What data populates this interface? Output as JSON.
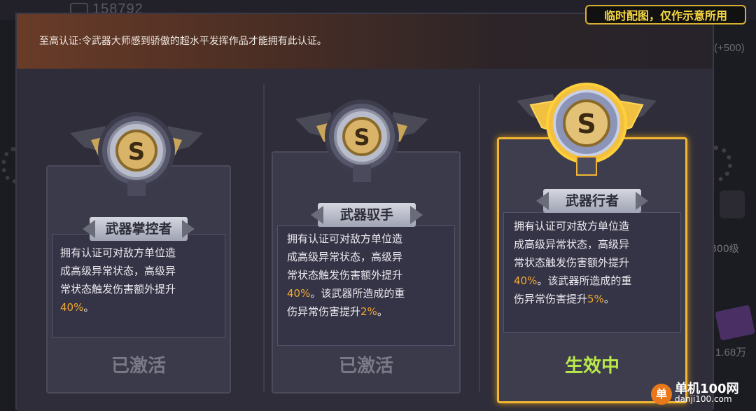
{
  "background": {
    "top_number": "158792",
    "right_bonus": "(+500)",
    "right_level": "300级",
    "right_price": "1.68万"
  },
  "notice": "临时配图，仅作示意所用",
  "header": {
    "text": "至高认证:令武器大师感到骄傲的超水平发挥作品才能拥有此认证。"
  },
  "cards": [
    {
      "title": "武器掌控者",
      "desc_lines": [
        "拥有认证可对敌方单位造",
        "成高级异常状态，高级异",
        "常状态触发伤害额外提升"
      ],
      "desc_hl": "40%",
      "desc_tail": "。",
      "status": "已激活",
      "active": false
    },
    {
      "title": "武器驭手",
      "desc_lines": [
        "拥有认证可对敌方单位造",
        "成高级异常状态，高级异",
        "常状态触发伤害额外提升"
      ],
      "desc_hl": "40%",
      "desc_mid": "。该武器所造成的重",
      "desc_line5": "伤异常伤害提升",
      "desc_hl2": "2%",
      "desc_tail": "。",
      "status": "已激活",
      "active": false
    },
    {
      "title": "武器行者",
      "desc_lines": [
        "拥有认证可对敌方单位造",
        "成高级异常状态，高级异",
        "常状态触发伤害额外提升"
      ],
      "desc_hl": "40%",
      "desc_mid": "。该武器所造成的重",
      "desc_line5": "伤异常伤害提升",
      "desc_hl2": "5%",
      "desc_tail": "。",
      "status": "生效中",
      "active": true
    }
  ],
  "badge_letter": "S",
  "watermark": {
    "logo": "单",
    "name": "单机100网",
    "url": "danji100.com"
  },
  "colors": {
    "highlight": "#f0a830",
    "active_border": "#f2b632",
    "status_active": "#b8e84a",
    "status_inactive": "#7a7986",
    "notice_text": "#f5d640"
  }
}
